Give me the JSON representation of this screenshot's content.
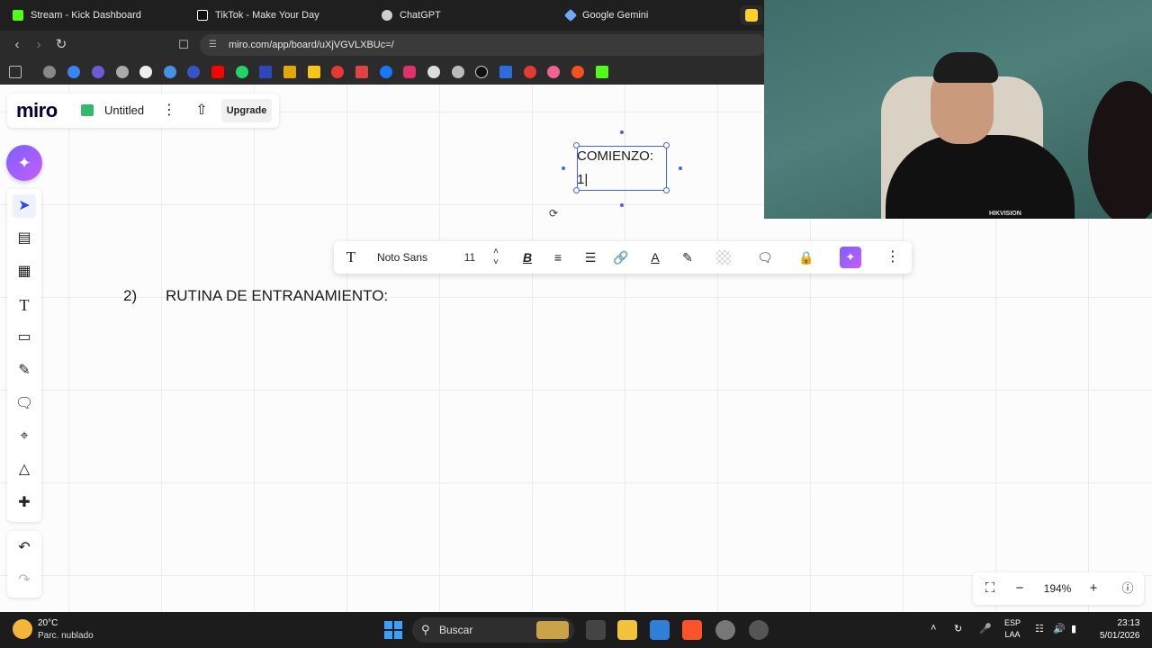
{
  "browser": {
    "tabs": [
      {
        "title": "Stream - Kick Dashboard",
        "icon": "kick-icon",
        "color": "#53fc18"
      },
      {
        "title": "TikTok - Make Your Day",
        "icon": "tiktok-icon",
        "color": "#ffffff"
      },
      {
        "title": "ChatGPT",
        "icon": "chatgpt-icon",
        "color": "#cfcfcf"
      },
      {
        "title": "Google Gemini",
        "icon": "gemini-icon",
        "color": "#6ea8ff"
      }
    ],
    "url": "miro.com/app/board/uXjVGVLXBUc=/"
  },
  "miro": {
    "logo": "miro",
    "board_title": "Untitled",
    "upgrade_label": "Upgrade",
    "brand_color": "#050038",
    "accent_color": "#4262ff"
  },
  "board": {
    "text_line1": "COMIENZO:",
    "text_line2": "1|",
    "heading_number": "2)",
    "heading_text": "RUTINA DE ENTRANAMIENTO:"
  },
  "format_toolbar": {
    "font": "Noto Sans",
    "size": "11",
    "bold": "B"
  },
  "zoom": {
    "level": "194%"
  },
  "webcam": {
    "shirt_logo": "HIKVISION"
  },
  "taskbar": {
    "temperature": "20°C",
    "condition": "Parc. nublado",
    "search_placeholder": "Buscar",
    "lang_line1": "ESP",
    "lang_line2": "LAA",
    "time": "23:13",
    "date": "5/01/2026"
  }
}
